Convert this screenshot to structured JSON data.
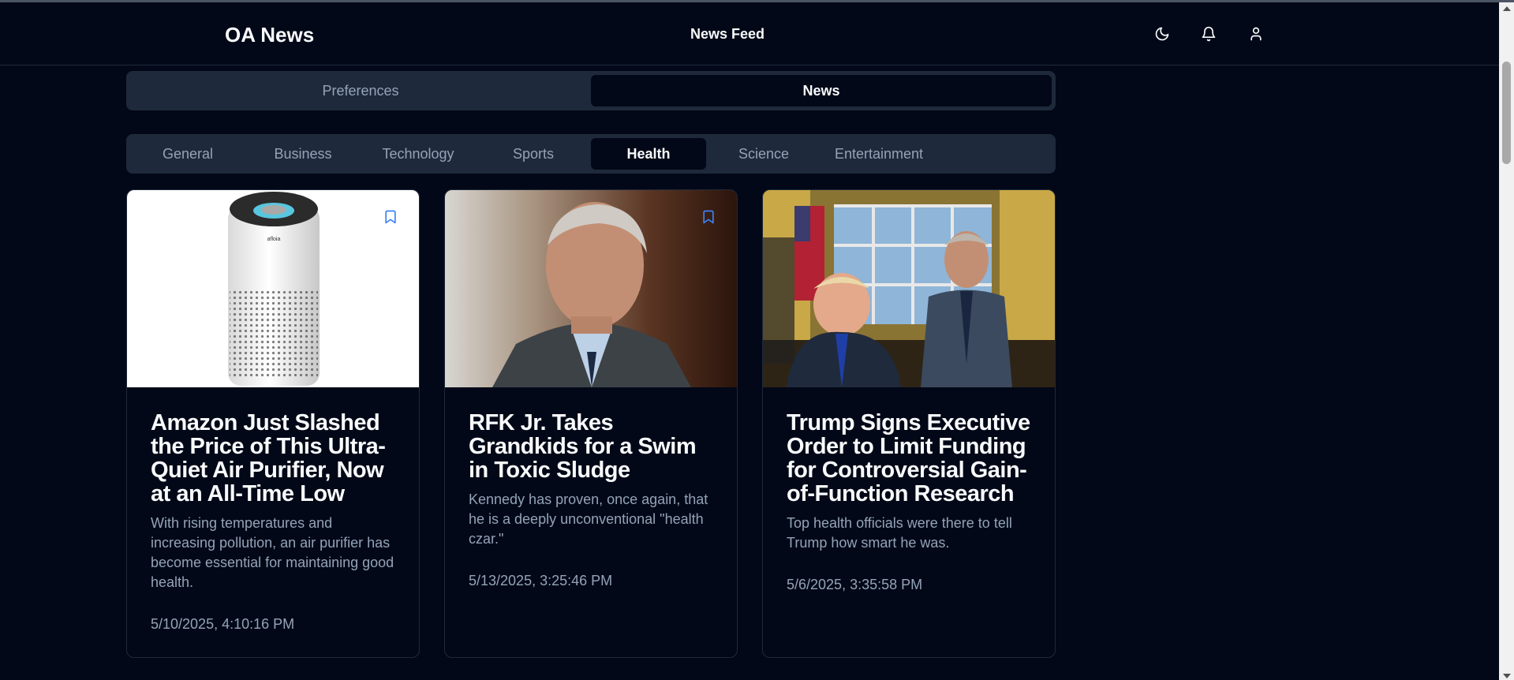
{
  "header": {
    "brand": "OA News",
    "nav_title": "News Feed",
    "icons": [
      "moon-icon",
      "bell-icon",
      "user-icon"
    ]
  },
  "top_tabs": [
    {
      "label": "Preferences",
      "active": false
    },
    {
      "label": "News",
      "active": true
    }
  ],
  "categories": [
    {
      "label": "General",
      "active": false
    },
    {
      "label": "Business",
      "active": false
    },
    {
      "label": "Technology",
      "active": false
    },
    {
      "label": "Sports",
      "active": false
    },
    {
      "label": "Health",
      "active": true
    },
    {
      "label": "Science",
      "active": false
    },
    {
      "label": "Entertainment",
      "active": false
    }
  ],
  "articles": [
    {
      "title": "Amazon Just Slashed the Price of This Ultra-Quiet Air Purifier, Now at an All-Time Low",
      "description": "With rising temperatures and increasing pollution, an air purifier has become essential for maintaining good health.",
      "date": "5/10/2025, 4:10:16 PM",
      "image": "air-purifier-photo",
      "product_label": "afloia"
    },
    {
      "title": "RFK Jr. Takes Grandkids for a Swim in Toxic Sludge",
      "description": "Kennedy has proven, once again, that he is a deeply unconventional \"health czar.\"",
      "date": "5/13/2025, 3:25:46 PM",
      "image": "portrait-photo"
    },
    {
      "title": "Trump Signs Executive Order to Limit Funding for Controversial Gain-of-Function Research",
      "description": "Top health officials were there to tell Trump how smart he was.",
      "date": "5/6/2025, 3:35:58 PM",
      "image": "oval-office-photo"
    }
  ],
  "colors": {
    "background": "#020817",
    "panel": "#1e293b",
    "muted_text": "#94a3b8",
    "accent": "#3b82f6"
  }
}
